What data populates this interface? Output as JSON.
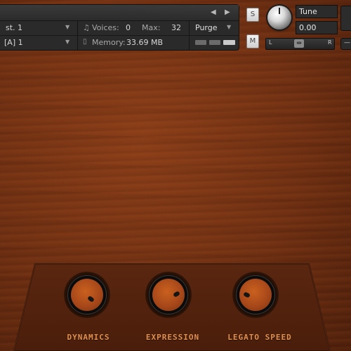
{
  "header": {
    "instrument_name": "st. 1",
    "midi_channel": "[A] 1",
    "voices_label": "Voices:",
    "voices_value": "0",
    "max_label": "Max:",
    "max_value": "32",
    "purge_label": "Purge",
    "memory_label": "Memory:",
    "memory_value": "33.69 MB"
  },
  "side_controls": {
    "solo_label": "S",
    "mute_label": "M",
    "tune_label": "Tune",
    "tune_value": "0.00",
    "pan_left_label": "L",
    "pan_right_label": "R"
  },
  "controls": {
    "knobs": [
      {
        "label": "DYNAMICS"
      },
      {
        "label": "EXPRESSION"
      },
      {
        "label": "LEGATO SPEED"
      }
    ]
  },
  "colors": {
    "wood": "#6e2f12",
    "knob_orange": "#a8481a",
    "label_orange": "#e09050"
  }
}
